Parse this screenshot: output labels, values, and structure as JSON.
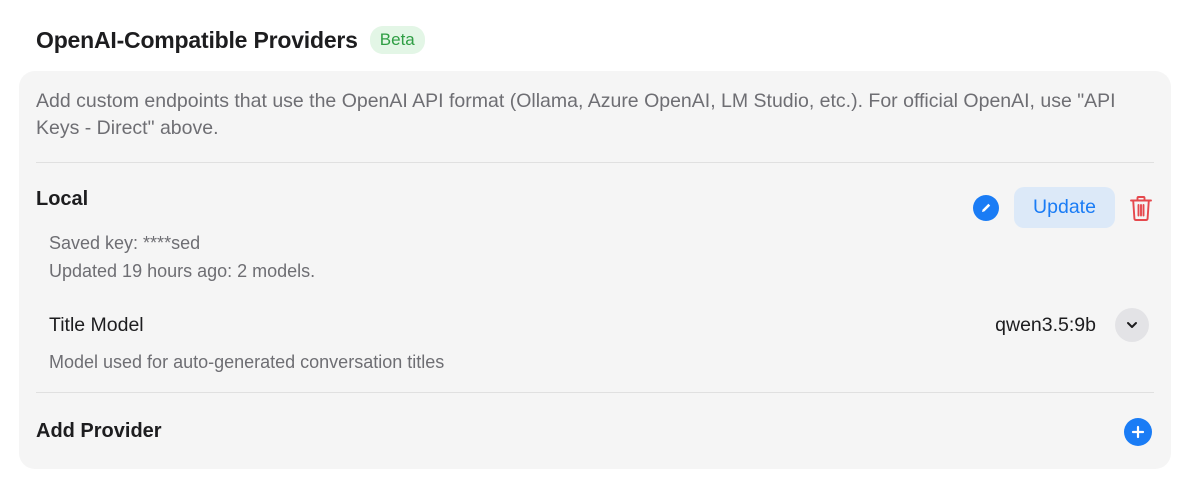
{
  "section": {
    "title": "OpenAI-Compatible Providers",
    "badge": "Beta"
  },
  "card": {
    "description": "Add custom endpoints that use the OpenAI API format (Ollama, Azure OpenAI, LM Studio, etc.). For official OpenAI, use \"API Keys - Direct\" above."
  },
  "provider": {
    "name": "Local",
    "update_label": "Update",
    "saved_key": "Saved key: ****sed",
    "updated": "Updated 19 hours ago: 2 models.",
    "edit_icon": "pencil-icon",
    "delete_icon": "trash-icon"
  },
  "title_model": {
    "label": "Title Model",
    "value": "qwen3.5:9b",
    "help": "Model used for auto-generated conversation titles",
    "dropdown_icon": "chevron-down-icon"
  },
  "add_provider": {
    "label": "Add Provider",
    "icon": "plus-icon"
  },
  "colors": {
    "accent": "#1a7cf5",
    "danger": "#e5484d",
    "badge_text": "#2f9e44",
    "badge_bg": "#e3f6e6",
    "card_bg": "#f5f5f5",
    "secondary_text": "#6e6e73"
  }
}
